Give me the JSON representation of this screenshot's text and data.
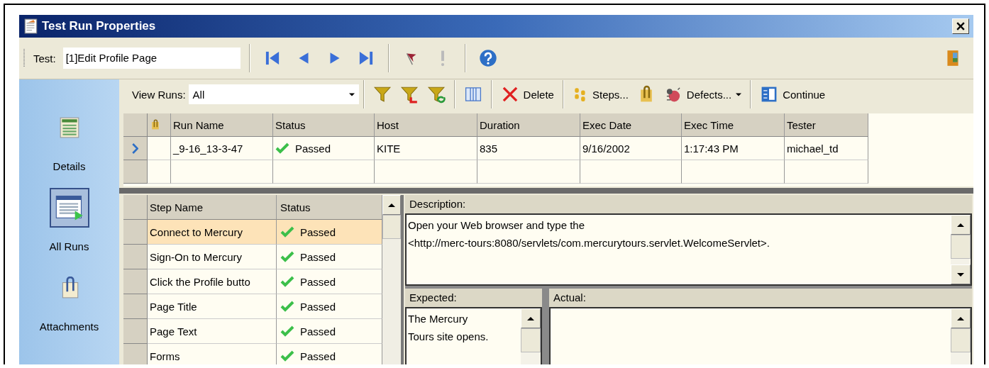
{
  "window": {
    "title": "Test Run Properties"
  },
  "test_bar": {
    "label": "Test:",
    "value": "[1]Edit Profile Page"
  },
  "view_runs": {
    "label": "View Runs:",
    "value": "All"
  },
  "actions": [
    {
      "kind": "delete",
      "label": "Delete"
    },
    {
      "kind": "steps",
      "label": "Steps..."
    },
    {
      "kind": "defects",
      "label": "Defects...",
      "dropdown": true
    },
    {
      "kind": "continue",
      "label": "Continue"
    }
  ],
  "sidebar": {
    "items": [
      {
        "kind": "details",
        "label": "Details",
        "selected": false
      },
      {
        "kind": "runs",
        "label": "All Runs",
        "selected": true
      },
      {
        "kind": "attachments",
        "label": "Attachments",
        "selected": false
      }
    ]
  },
  "runs": {
    "columns": [
      "Run Name",
      "Status",
      "Host",
      "Duration",
      "Exec Date",
      "Exec Time",
      "Tester"
    ],
    "rows": [
      {
        "selected": true,
        "cells": [
          "_9-16_13-3-47",
          "Passed",
          "KITE",
          "835",
          "9/16/2002",
          "1:17:43 PM",
          "michael_td"
        ]
      }
    ]
  },
  "steps": {
    "columns": [
      "Step Name",
      "Status"
    ],
    "rows": [
      {
        "name": "Connect to Mercury",
        "status": "Passed",
        "selected": true
      },
      {
        "name": "Sign-On to Mercury",
        "status": "Passed",
        "selected": false
      },
      {
        "name": "Click the Profile butto",
        "status": "Passed",
        "selected": false
      },
      {
        "name": "Page Title",
        "status": "Passed",
        "selected": false
      },
      {
        "name": "Page Text",
        "status": "Passed",
        "selected": false
      },
      {
        "name": "Forms",
        "status": "Passed",
        "selected": false
      }
    ]
  },
  "description": {
    "label": "Description:",
    "text": "Open your Web browser and type the\n<http://merc-tours:8080/servlets/com.mercurytours.servlet.WelcomeServlet>."
  },
  "expected": {
    "label": "Expected:",
    "text": "The Mercury\nTours site opens."
  },
  "actual": {
    "label": "Actual:"
  }
}
